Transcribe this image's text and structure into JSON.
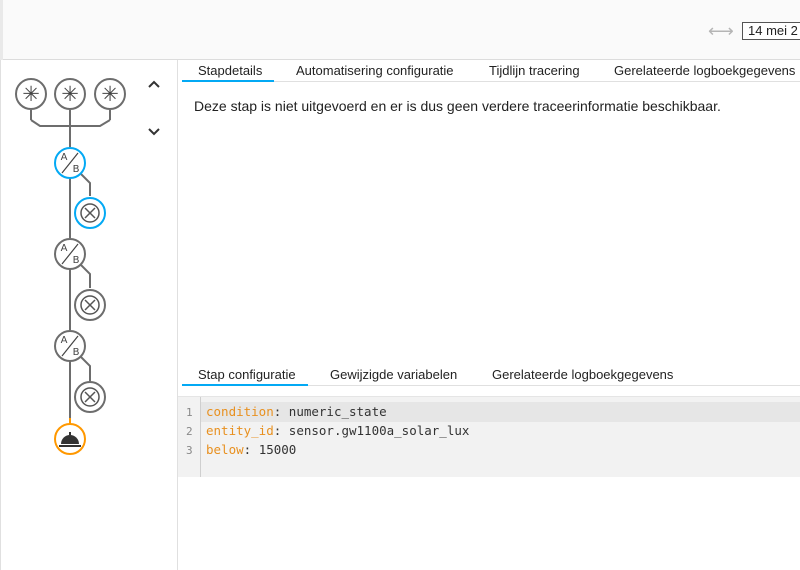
{
  "header": {
    "range_icon": "double-arrow-icon",
    "date_value": "14 mei 2"
  },
  "graph": {
    "nav_up_icon": "chevron-up-icon",
    "nav_down_icon": "chevron-down-icon",
    "trigger_icon": "asterisk-icon",
    "condition_label": "A/B",
    "condition_icon": "choose-icon",
    "skip_icon": "close-circle-icon",
    "action_icon": "service-bell-icon",
    "colors": {
      "active": "#03a9f4",
      "default": "#6d6d6d",
      "last": "#ff9800"
    }
  },
  "tabs_top": [
    "Stapdetails",
    "Automatisering configuratie",
    "Tijdlijn tracering",
    "Gerelateerde logboekgegevens"
  ],
  "trace_message": "Deze stap is niet uitgevoerd en er is dus geen verdere traceerinformatie beschikbaar.",
  "tabs_bottom": [
    "Stap configuratie",
    "Gewijzigde variabelen",
    "Gerelateerde logboekgegevens"
  ],
  "code": {
    "lines": [
      {
        "num": "1",
        "key": "condition",
        "value": " numeric_state"
      },
      {
        "num": "2",
        "key": "entity_id",
        "value": " sensor.gw1100a_solar_lux"
      },
      {
        "num": "3",
        "key": "below",
        "value": " 15000"
      }
    ]
  }
}
